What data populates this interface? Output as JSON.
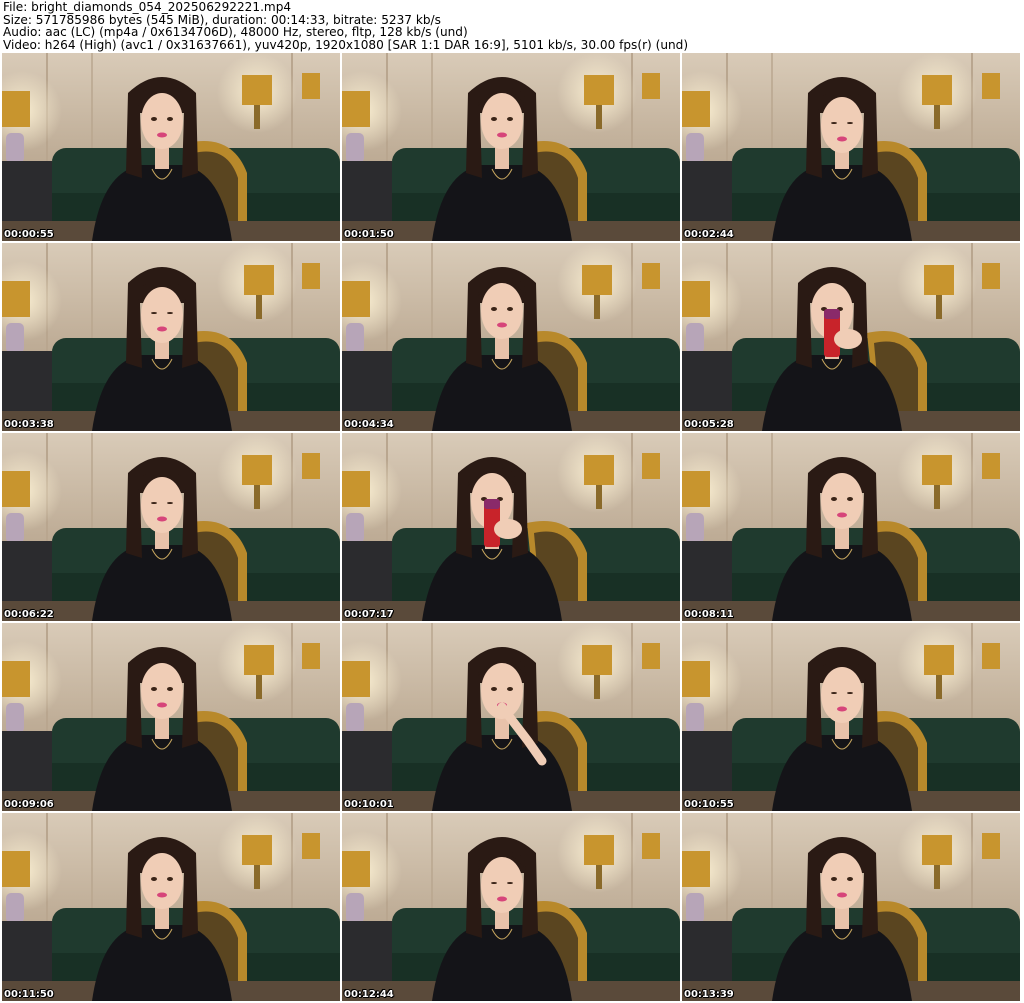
{
  "header": {
    "file_line": "File: bright_diamonds_054_202506292221.mp4",
    "size_line": "Size: 571785986 bytes (545 MiB), duration: 00:14:33, bitrate: 5237 kb/s",
    "audio_line": "Audio: aac (LC) (mp4a / 0x6134706D), 48000 Hz, stereo, fltp, 128 kb/s (und)",
    "video_line": "Video: h264 (High) (avc1 / 0x31637661), yuv420p, 1920x1080 [SAR 1:1 DAR 16:9], 5101 kb/s, 30.00 fps(r) (und)"
  },
  "thumbnails": [
    {
      "timestamp": "00:00:55",
      "pose": "neutral"
    },
    {
      "timestamp": "00:01:50",
      "pose": "smile"
    },
    {
      "timestamp": "00:02:44",
      "pose": "down"
    },
    {
      "timestamp": "00:03:38",
      "pose": "down"
    },
    {
      "timestamp": "00:04:34",
      "pose": "smile"
    },
    {
      "timestamp": "00:05:28",
      "pose": "can"
    },
    {
      "timestamp": "00:06:22",
      "pose": "down"
    },
    {
      "timestamp": "00:07:17",
      "pose": "can"
    },
    {
      "timestamp": "00:08:11",
      "pose": "neutral"
    },
    {
      "timestamp": "00:09:06",
      "pose": "neutral"
    },
    {
      "timestamp": "00:10:01",
      "pose": "hand"
    },
    {
      "timestamp": "00:10:55",
      "pose": "down"
    },
    {
      "timestamp": "00:11:50",
      "pose": "neutral"
    },
    {
      "timestamp": "00:12:44",
      "pose": "down"
    },
    {
      "timestamp": "00:13:39",
      "pose": "neutral"
    }
  ],
  "colors": {
    "wall": "#c9b8a3",
    "sofa": "#1f3a2e",
    "shirt": "#141418",
    "hair": "#2a1a14",
    "lamp": "#c8952e",
    "can": "#c8232a"
  }
}
